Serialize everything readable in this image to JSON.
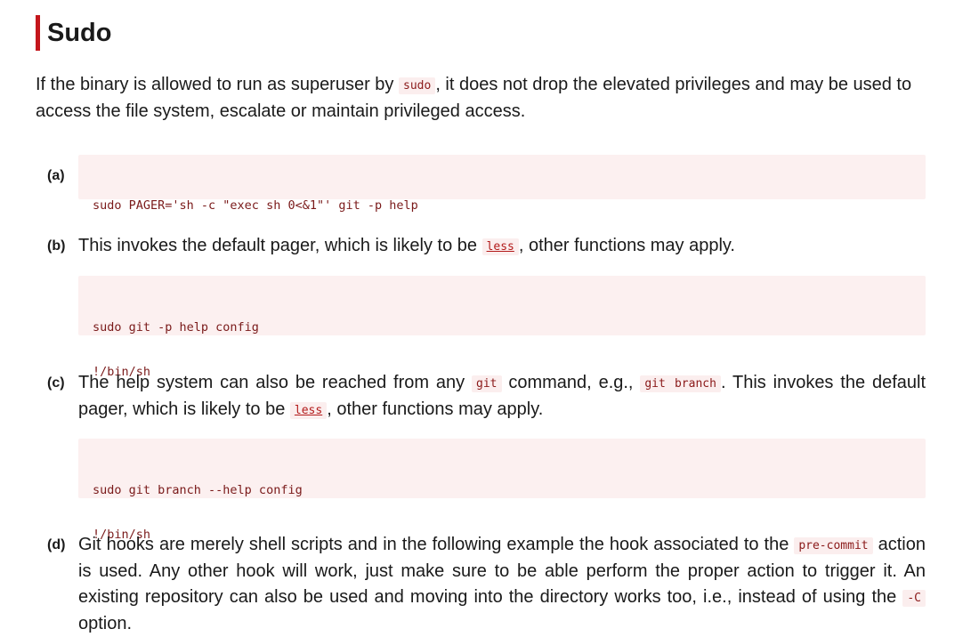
{
  "heading": "Sudo",
  "intro": {
    "before": "If the binary is allowed to run as superuser by ",
    "code": "sudo",
    "after": ", it does not drop the elevated privileges and may be used to access the file system, escalate or maintain privileged access."
  },
  "items": {
    "a": {
      "label": "(a)",
      "code_lines": [
        "sudo PAGER='sh -c \"exec sh 0<&1\"' git -p help"
      ]
    },
    "b": {
      "label": "(b)",
      "text_before": "This invokes the default pager, which is likely to be ",
      "link": "less",
      "text_after": ", other functions may apply.",
      "code_lines": [
        "sudo git -p help config",
        "!/bin/sh"
      ]
    },
    "c": {
      "label": "(c)",
      "text_1": "The help system can also be reached from any ",
      "code_1": "git",
      "text_2": " command, e.g., ",
      "code_2": "git branch",
      "text_3": ". This invokes the default pager, which is likely to be ",
      "link": "less",
      "text_4": ", other functions may apply.",
      "code_lines": [
        "sudo git branch --help config",
        "!/bin/sh"
      ]
    },
    "d": {
      "label": "(d)",
      "text_1": "Git hooks are merely shell scripts and in the following example the hook associated to the ",
      "code_1": "pre-commit",
      "text_2": " action is used. Any other hook will work, just make sure to be able perform the proper action to trigger it. An existing repository can also be used and moving into the directory works too, i.e., instead of using the ",
      "code_2": "-C",
      "text_3": " option."
    }
  },
  "colors": {
    "accent": "#c4161c",
    "code_bg": "#fcf0f0",
    "code_text": "#7a1a1a"
  }
}
